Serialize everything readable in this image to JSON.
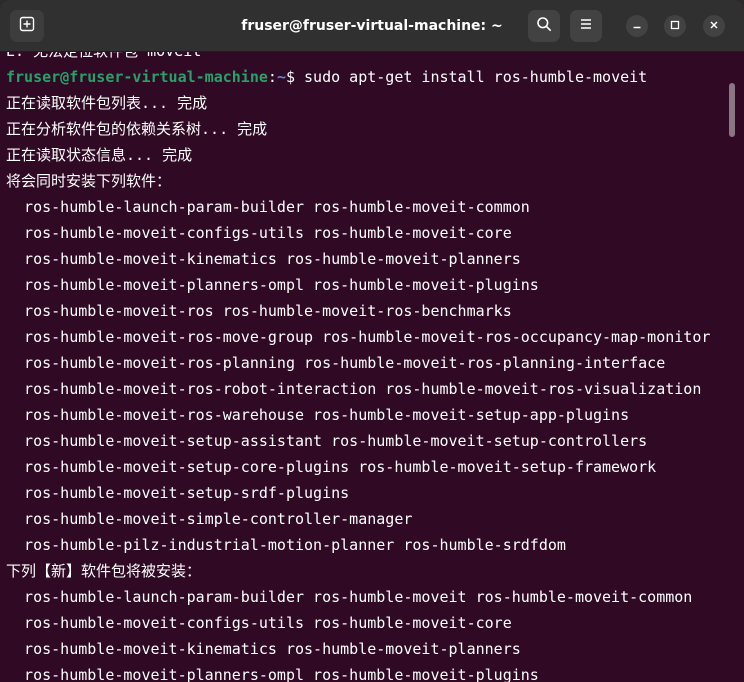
{
  "window": {
    "title": "fruser@fruser-virtual-machine: ~"
  },
  "icons": {
    "new_tab": "new-tab-icon",
    "search": "search-icon",
    "menu": "hamburger-menu-icon",
    "minimize": "minimize-icon",
    "maximize": "maximize-icon",
    "close": "close-icon"
  },
  "colors": {
    "terminal_bg": "#300a24",
    "prompt_user": "#26a269",
    "prompt_path": "#5f87d7",
    "text": "#ffffff"
  },
  "terminal": {
    "top_partial": "E: 无法定位软件包 moveit",
    "prompt": {
      "user_host": "fruser@fruser-virtual-machine",
      "sep": ":",
      "path": "~",
      "dollar": "$ ",
      "command": "sudo apt-get install ros-humble-moveit"
    },
    "lines": [
      "正在读取软件包列表... 完成",
      "正在分析软件包的依赖关系树... 完成",
      "正在读取状态信息... 完成",
      "将会同时安装下列软件：",
      "  ros-humble-launch-param-builder ros-humble-moveit-common",
      "  ros-humble-moveit-configs-utils ros-humble-moveit-core",
      "  ros-humble-moveit-kinematics ros-humble-moveit-planners",
      "  ros-humble-moveit-planners-ompl ros-humble-moveit-plugins",
      "  ros-humble-moveit-ros ros-humble-moveit-ros-benchmarks",
      "  ros-humble-moveit-ros-move-group ros-humble-moveit-ros-occupancy-map-monitor",
      "  ros-humble-moveit-ros-planning ros-humble-moveit-ros-planning-interface",
      "  ros-humble-moveit-ros-robot-interaction ros-humble-moveit-ros-visualization",
      "  ros-humble-moveit-ros-warehouse ros-humble-moveit-setup-app-plugins",
      "  ros-humble-moveit-setup-assistant ros-humble-moveit-setup-controllers",
      "  ros-humble-moveit-setup-core-plugins ros-humble-moveit-setup-framework",
      "  ros-humble-moveit-setup-srdf-plugins",
      "  ros-humble-moveit-simple-controller-manager",
      "  ros-humble-pilz-industrial-motion-planner ros-humble-srdfdom",
      "下列【新】软件包将被安装：",
      "  ros-humble-launch-param-builder ros-humble-moveit ros-humble-moveit-common",
      "  ros-humble-moveit-configs-utils ros-humble-moveit-core",
      "  ros-humble-moveit-kinematics ros-humble-moveit-planners",
      "  ros-humble-moveit-planners-ompl ros-humble-moveit-plugins"
    ]
  }
}
